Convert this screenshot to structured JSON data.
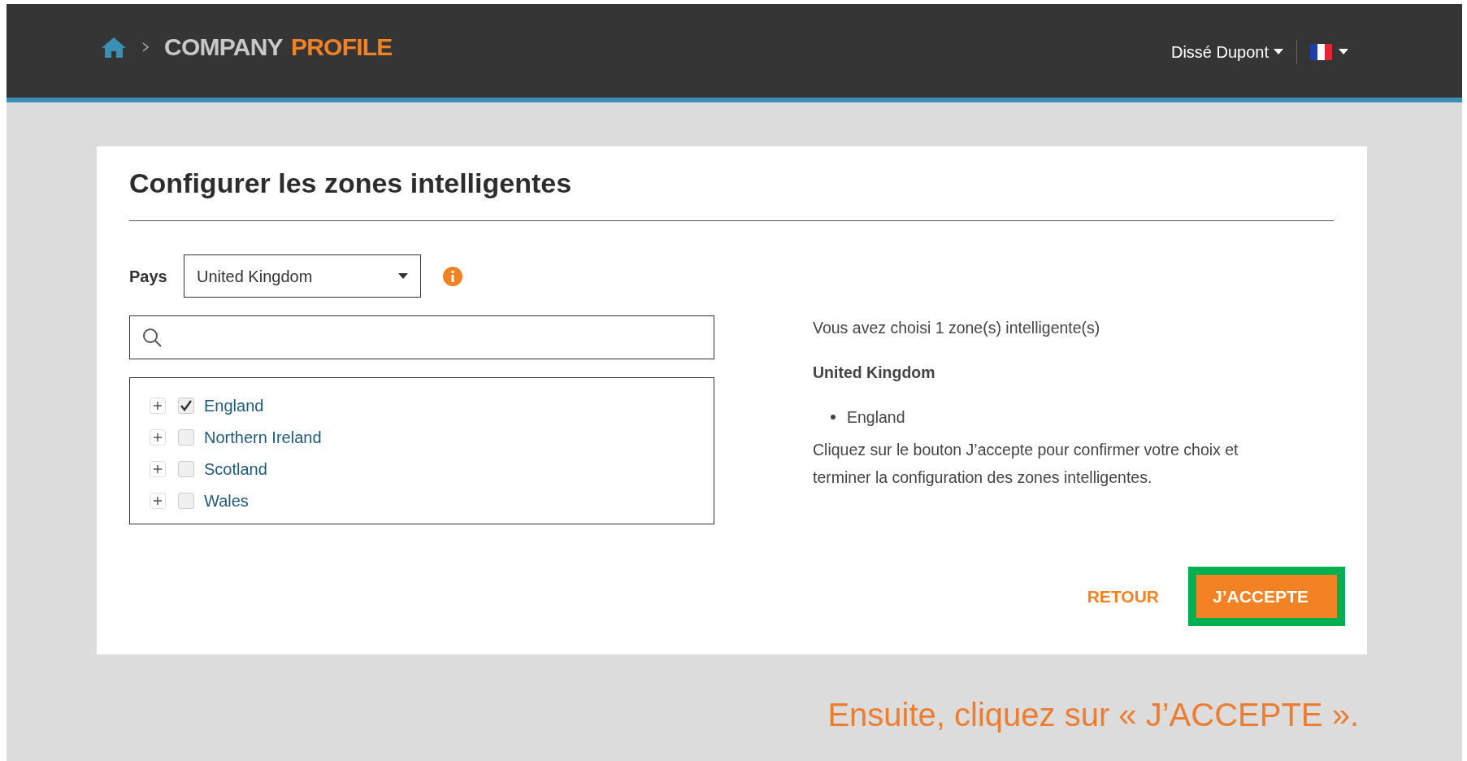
{
  "header": {
    "breadcrumb": {
      "prefix": "COMPANY",
      "emphasis": "PROFILE"
    },
    "user": "Dissé Dupont"
  },
  "card": {
    "title": "Configurer les zones intelligentes",
    "country": {
      "label": "Pays",
      "value": "United Kingdom"
    },
    "tree": [
      {
        "label": "England",
        "checked": true,
        "expanded": false
      },
      {
        "label": "Northern Ireland",
        "checked": false,
        "expanded": false
      },
      {
        "label": "Scotland",
        "checked": false,
        "expanded": false
      },
      {
        "label": "Wales",
        "checked": false,
        "expanded": false
      }
    ],
    "summary": {
      "count_text": "Vous avez choisi 1 zone(s) intelligente(s)",
      "country": "United Kingdom",
      "zones": [
        "England"
      ],
      "instructions": "Cliquez sur le bouton J’accepte pour confirmer votre choix et terminer la configuration des zones intelligentes."
    },
    "buttons": {
      "back": "RETOUR",
      "accept": "J’ACCEPTE",
      "accept_highlighted": true
    }
  },
  "caption": "Ensuite, cliquez sur « J’ACCEPTE »."
}
